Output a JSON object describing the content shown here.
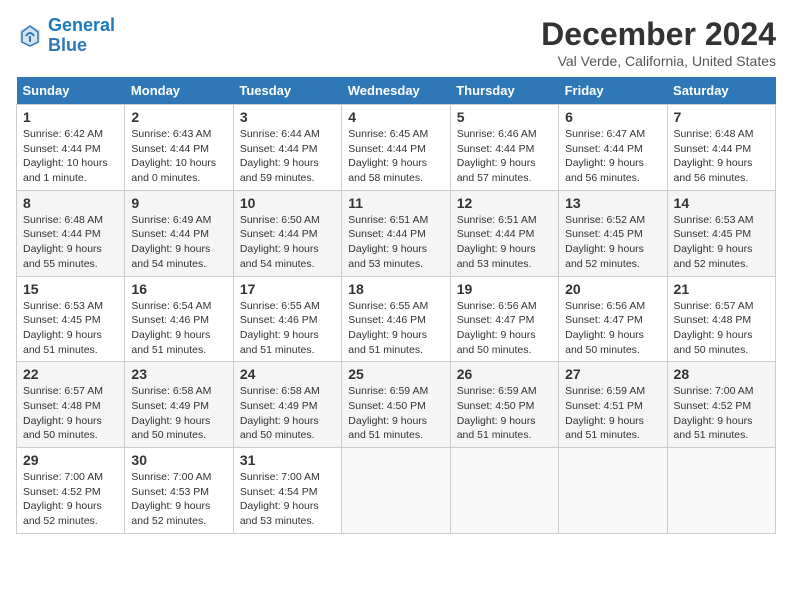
{
  "logo": {
    "line1": "General",
    "line2": "Blue"
  },
  "title": "December 2024",
  "subtitle": "Val Verde, California, United States",
  "days_of_week": [
    "Sunday",
    "Monday",
    "Tuesday",
    "Wednesday",
    "Thursday",
    "Friday",
    "Saturday"
  ],
  "weeks": [
    [
      {
        "day": "1",
        "sunrise": "Sunrise: 6:42 AM",
        "sunset": "Sunset: 4:44 PM",
        "daylight": "Daylight: 10 hours and 1 minute."
      },
      {
        "day": "2",
        "sunrise": "Sunrise: 6:43 AM",
        "sunset": "Sunset: 4:44 PM",
        "daylight": "Daylight: 10 hours and 0 minutes."
      },
      {
        "day": "3",
        "sunrise": "Sunrise: 6:44 AM",
        "sunset": "Sunset: 4:44 PM",
        "daylight": "Daylight: 9 hours and 59 minutes."
      },
      {
        "day": "4",
        "sunrise": "Sunrise: 6:45 AM",
        "sunset": "Sunset: 4:44 PM",
        "daylight": "Daylight: 9 hours and 58 minutes."
      },
      {
        "day": "5",
        "sunrise": "Sunrise: 6:46 AM",
        "sunset": "Sunset: 4:44 PM",
        "daylight": "Daylight: 9 hours and 57 minutes."
      },
      {
        "day": "6",
        "sunrise": "Sunrise: 6:47 AM",
        "sunset": "Sunset: 4:44 PM",
        "daylight": "Daylight: 9 hours and 56 minutes."
      },
      {
        "day": "7",
        "sunrise": "Sunrise: 6:48 AM",
        "sunset": "Sunset: 4:44 PM",
        "daylight": "Daylight: 9 hours and 56 minutes."
      }
    ],
    [
      {
        "day": "8",
        "sunrise": "Sunrise: 6:48 AM",
        "sunset": "Sunset: 4:44 PM",
        "daylight": "Daylight: 9 hours and 55 minutes."
      },
      {
        "day": "9",
        "sunrise": "Sunrise: 6:49 AM",
        "sunset": "Sunset: 4:44 PM",
        "daylight": "Daylight: 9 hours and 54 minutes."
      },
      {
        "day": "10",
        "sunrise": "Sunrise: 6:50 AM",
        "sunset": "Sunset: 4:44 PM",
        "daylight": "Daylight: 9 hours and 54 minutes."
      },
      {
        "day": "11",
        "sunrise": "Sunrise: 6:51 AM",
        "sunset": "Sunset: 4:44 PM",
        "daylight": "Daylight: 9 hours and 53 minutes."
      },
      {
        "day": "12",
        "sunrise": "Sunrise: 6:51 AM",
        "sunset": "Sunset: 4:44 PM",
        "daylight": "Daylight: 9 hours and 53 minutes."
      },
      {
        "day": "13",
        "sunrise": "Sunrise: 6:52 AM",
        "sunset": "Sunset: 4:45 PM",
        "daylight": "Daylight: 9 hours and 52 minutes."
      },
      {
        "day": "14",
        "sunrise": "Sunrise: 6:53 AM",
        "sunset": "Sunset: 4:45 PM",
        "daylight": "Daylight: 9 hours and 52 minutes."
      }
    ],
    [
      {
        "day": "15",
        "sunrise": "Sunrise: 6:53 AM",
        "sunset": "Sunset: 4:45 PM",
        "daylight": "Daylight: 9 hours and 51 minutes."
      },
      {
        "day": "16",
        "sunrise": "Sunrise: 6:54 AM",
        "sunset": "Sunset: 4:46 PM",
        "daylight": "Daylight: 9 hours and 51 minutes."
      },
      {
        "day": "17",
        "sunrise": "Sunrise: 6:55 AM",
        "sunset": "Sunset: 4:46 PM",
        "daylight": "Daylight: 9 hours and 51 minutes."
      },
      {
        "day": "18",
        "sunrise": "Sunrise: 6:55 AM",
        "sunset": "Sunset: 4:46 PM",
        "daylight": "Daylight: 9 hours and 51 minutes."
      },
      {
        "day": "19",
        "sunrise": "Sunrise: 6:56 AM",
        "sunset": "Sunset: 4:47 PM",
        "daylight": "Daylight: 9 hours and 50 minutes."
      },
      {
        "day": "20",
        "sunrise": "Sunrise: 6:56 AM",
        "sunset": "Sunset: 4:47 PM",
        "daylight": "Daylight: 9 hours and 50 minutes."
      },
      {
        "day": "21",
        "sunrise": "Sunrise: 6:57 AM",
        "sunset": "Sunset: 4:48 PM",
        "daylight": "Daylight: 9 hours and 50 minutes."
      }
    ],
    [
      {
        "day": "22",
        "sunrise": "Sunrise: 6:57 AM",
        "sunset": "Sunset: 4:48 PM",
        "daylight": "Daylight: 9 hours and 50 minutes."
      },
      {
        "day": "23",
        "sunrise": "Sunrise: 6:58 AM",
        "sunset": "Sunset: 4:49 PM",
        "daylight": "Daylight: 9 hours and 50 minutes."
      },
      {
        "day": "24",
        "sunrise": "Sunrise: 6:58 AM",
        "sunset": "Sunset: 4:49 PM",
        "daylight": "Daylight: 9 hours and 50 minutes."
      },
      {
        "day": "25",
        "sunrise": "Sunrise: 6:59 AM",
        "sunset": "Sunset: 4:50 PM",
        "daylight": "Daylight: 9 hours and 51 minutes."
      },
      {
        "day": "26",
        "sunrise": "Sunrise: 6:59 AM",
        "sunset": "Sunset: 4:50 PM",
        "daylight": "Daylight: 9 hours and 51 minutes."
      },
      {
        "day": "27",
        "sunrise": "Sunrise: 6:59 AM",
        "sunset": "Sunset: 4:51 PM",
        "daylight": "Daylight: 9 hours and 51 minutes."
      },
      {
        "day": "28",
        "sunrise": "Sunrise: 7:00 AM",
        "sunset": "Sunset: 4:52 PM",
        "daylight": "Daylight: 9 hours and 51 minutes."
      }
    ],
    [
      {
        "day": "29",
        "sunrise": "Sunrise: 7:00 AM",
        "sunset": "Sunset: 4:52 PM",
        "daylight": "Daylight: 9 hours and 52 minutes."
      },
      {
        "day": "30",
        "sunrise": "Sunrise: 7:00 AM",
        "sunset": "Sunset: 4:53 PM",
        "daylight": "Daylight: 9 hours and 52 minutes."
      },
      {
        "day": "31",
        "sunrise": "Sunrise: 7:00 AM",
        "sunset": "Sunset: 4:54 PM",
        "daylight": "Daylight: 9 hours and 53 minutes."
      },
      null,
      null,
      null,
      null
    ]
  ]
}
